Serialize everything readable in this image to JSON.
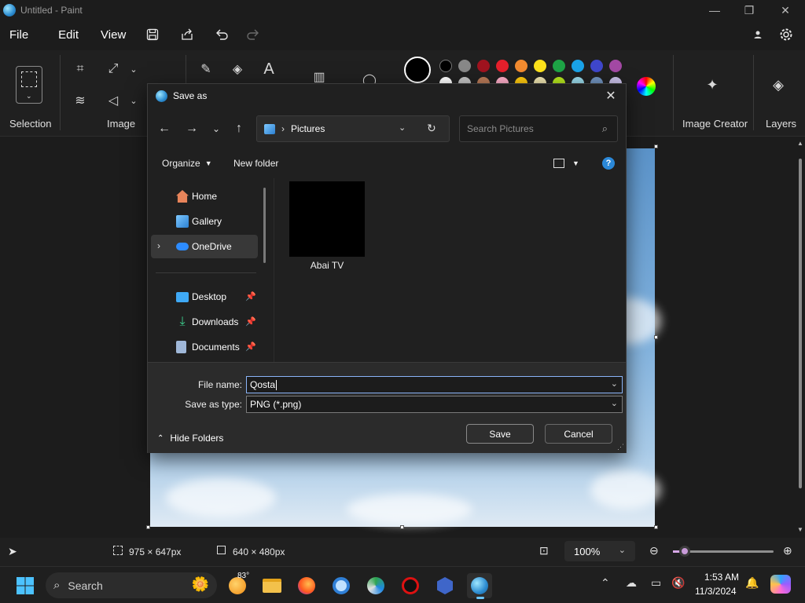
{
  "window": {
    "title": "Untitled - Paint"
  },
  "menu": {
    "file": "File",
    "edit": "Edit",
    "view": "View"
  },
  "ribbon": {
    "selection_label": "Selection",
    "image_label": "Image",
    "image_creator_label": "Image Creator",
    "layers_label": "Layers",
    "colors_row1": [
      "#000000",
      "#888888",
      "#a0131f",
      "#e5202c",
      "#f28b30",
      "#fde21b",
      "#1ea446",
      "#1aa3e8",
      "#3f47cc",
      "#a349a4"
    ],
    "colors_row2": [
      "#ffffff",
      "#c3c3c3",
      "#b97a57",
      "#ffaec9",
      "#ffc90e",
      "#efe4b0",
      "#b5e61d",
      "#99d9ea",
      "#7092be",
      "#c8bfe7"
    ]
  },
  "dialog": {
    "title": "Save as",
    "address": "Pictures",
    "search_placeholder": "Search Pictures",
    "organize": "Organize",
    "new_folder": "New folder",
    "nav": {
      "home": "Home",
      "gallery": "Gallery",
      "onedrive": "OneDrive",
      "desktop": "Desktop",
      "downloads": "Downloads",
      "documents": "Documents"
    },
    "files": [
      {
        "name": "Abai TV"
      }
    ],
    "file_name_label": "File name:",
    "file_name_value": "Qosta",
    "save_type_label": "Save as type:",
    "save_type_value": "PNG (*.png)",
    "hide_folders": "Hide Folders",
    "save": "Save",
    "cancel": "Cancel"
  },
  "status": {
    "selection_size": "975 × 647px",
    "canvas_size": "640 × 480px",
    "zoom": "100%",
    "zoom_slider_fraction": 0.12
  },
  "taskbar": {
    "search": "Search",
    "weather_temp": "83°",
    "time": "1:53 AM",
    "date": "11/3/2024"
  }
}
